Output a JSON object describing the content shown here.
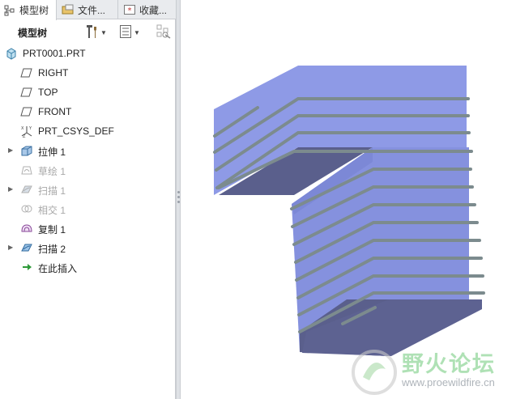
{
  "tabs": [
    {
      "label": "模型树",
      "icon": "model-tree-icon",
      "active": true
    },
    {
      "label": "文件...",
      "icon": "folder-icon",
      "active": false
    },
    {
      "label": "收藏...",
      "icon": "favorites-icon",
      "active": false
    }
  ],
  "toolbar": {
    "title": "模型树",
    "settings_icon": "tools-icon",
    "show_icon": "tree-columns-icon",
    "filter_icon": "tree-filter-icon"
  },
  "tree": {
    "items": [
      {
        "label": "PRT0001.PRT",
        "icon": "part-icon",
        "expandable": false,
        "dim": false
      },
      {
        "label": "RIGHT",
        "icon": "datum-plane-icon",
        "expandable": false,
        "dim": false
      },
      {
        "label": "TOP",
        "icon": "datum-plane-icon",
        "expandable": false,
        "dim": false
      },
      {
        "label": "FRONT",
        "icon": "datum-plane-icon",
        "expandable": false,
        "dim": false
      },
      {
        "label": "PRT_CSYS_DEF",
        "icon": "coordinate-system-icon",
        "expandable": false,
        "dim": false
      },
      {
        "label": "拉伸 1",
        "icon": "extrude-icon",
        "expandable": true,
        "dim": false
      },
      {
        "label": "草绘 1",
        "icon": "sketch-icon",
        "expandable": false,
        "dim": true
      },
      {
        "label": "扫描 1",
        "icon": "sweep-icon",
        "expandable": true,
        "dim": true
      },
      {
        "label": "相交 1",
        "icon": "intersect-icon",
        "expandable": false,
        "dim": true
      },
      {
        "label": "复制 1",
        "icon": "copy-icon",
        "expandable": false,
        "dim": false
      },
      {
        "label": "扫描 2",
        "icon": "sweep-icon",
        "expandable": true,
        "dim": false
      },
      {
        "label": "在此插入",
        "icon": "insert-here-icon",
        "expandable": false,
        "dim": false
      }
    ]
  },
  "viewport": {
    "model_icon": "3d-model-view",
    "colors": {
      "top": "#8e9ae6",
      "side": "#5a5f8c",
      "front": "#8591de",
      "wire": "#7c8b8e"
    }
  },
  "watermark": {
    "text": "野火论坛",
    "url": "www.proewildfire.cn"
  }
}
